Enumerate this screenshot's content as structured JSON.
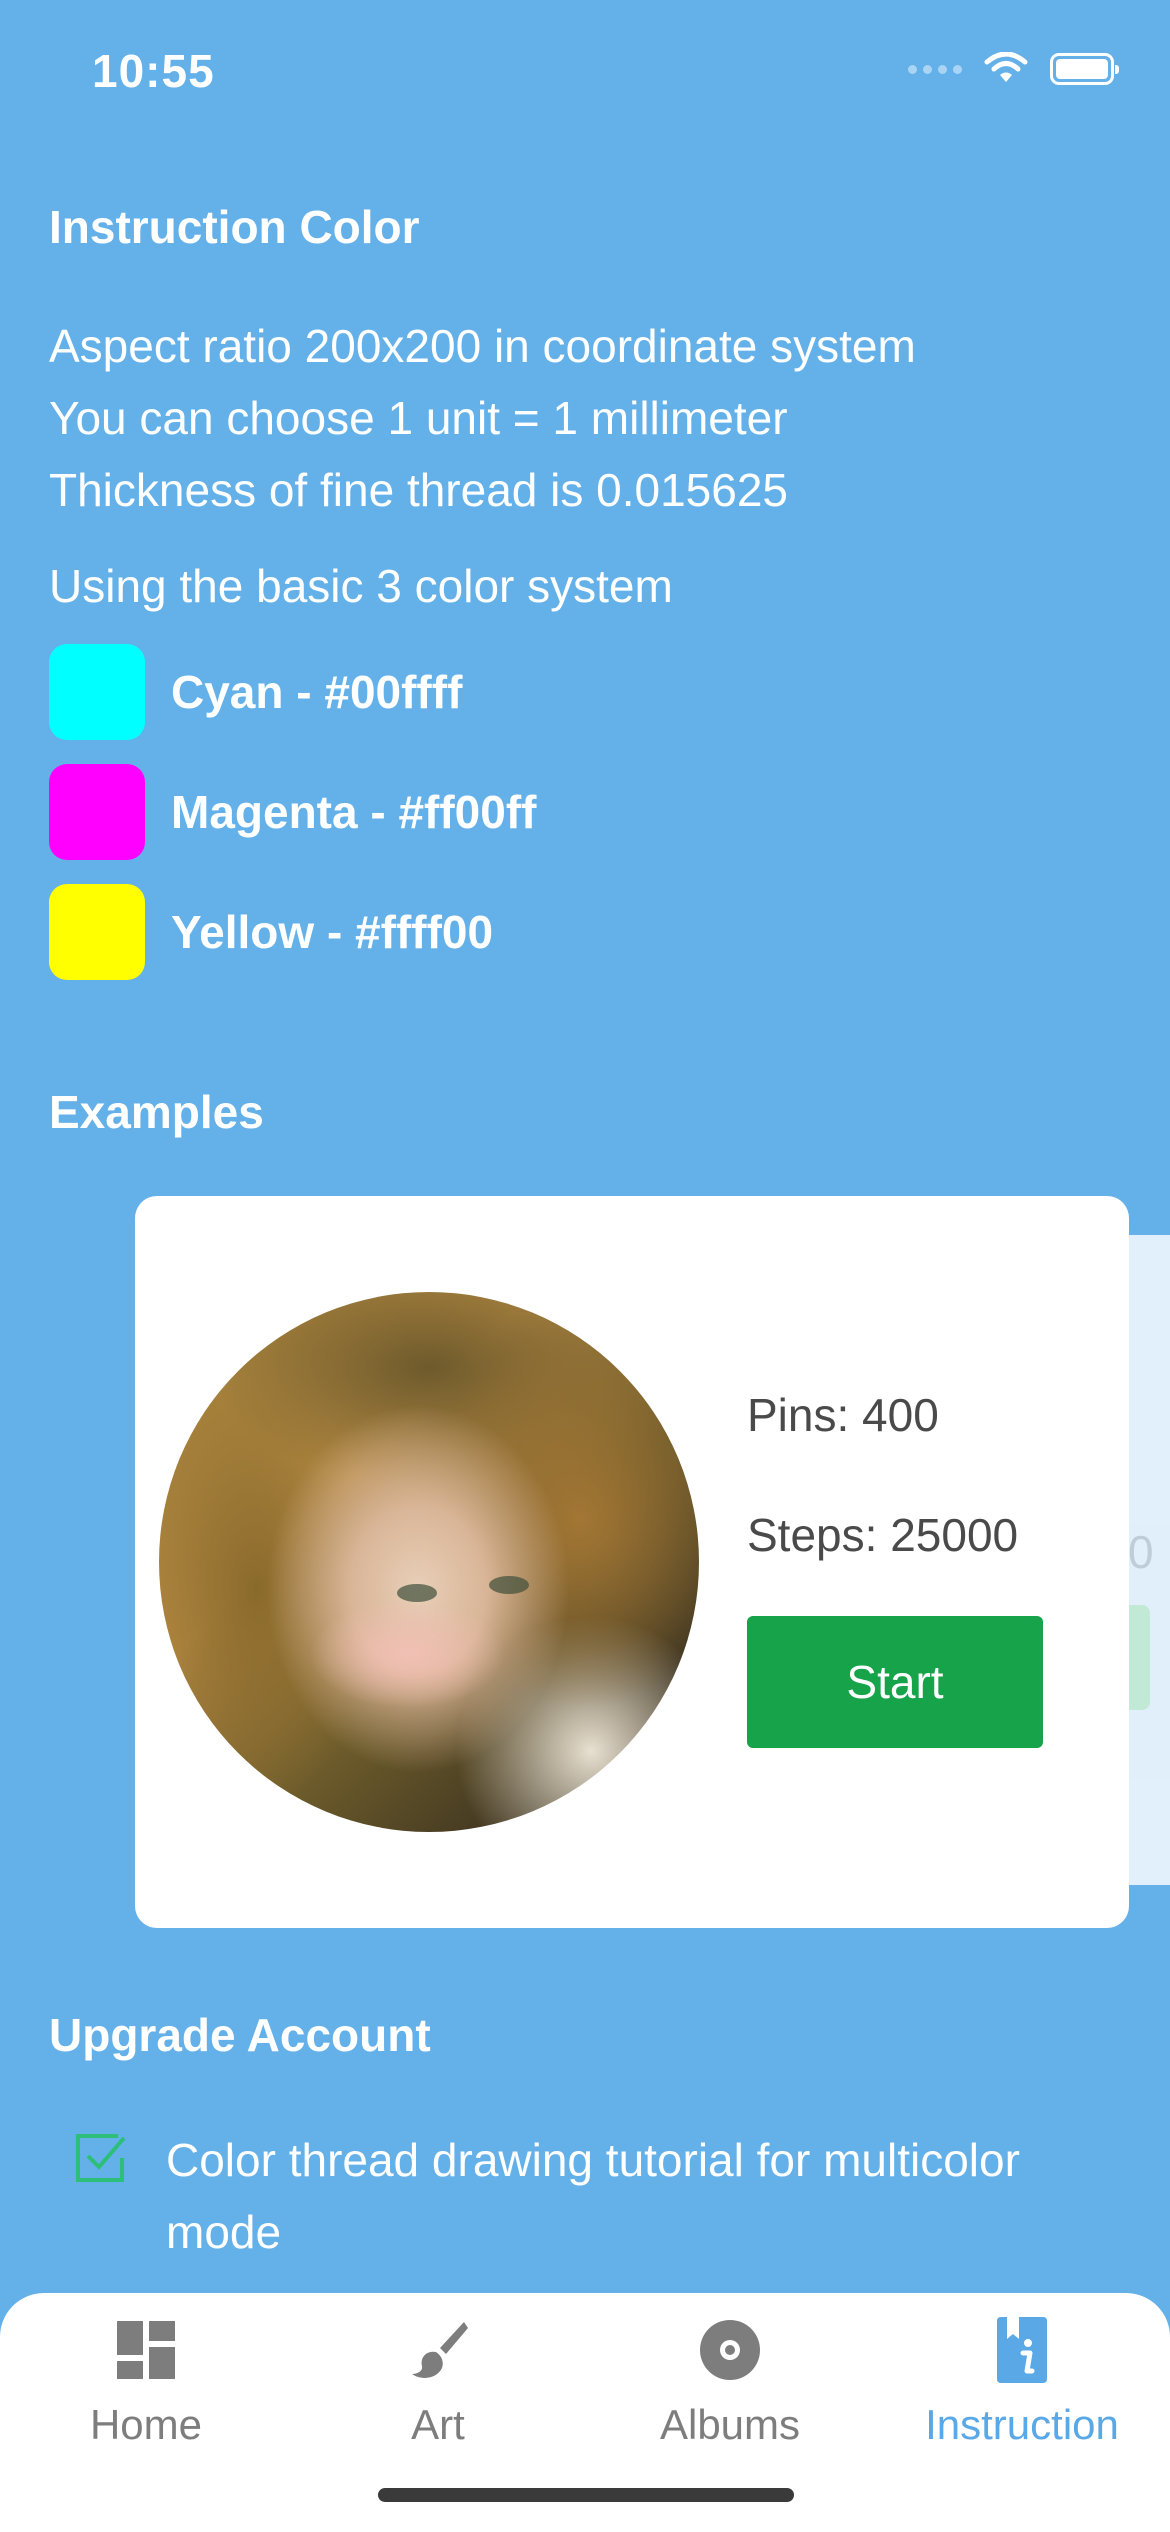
{
  "status_bar": {
    "time": "10:55"
  },
  "instruction": {
    "title": "Instruction Color",
    "lines": [
      "Aspect ratio 200x200 in coordinate system",
      "You can choose 1 unit = 1 millimeter",
      "Thickness of fine thread is 0.015625"
    ],
    "basic_line": "Using the basic 3 color system",
    "colors": [
      {
        "label": "Cyan - #00ffff",
        "hex": "#00ffff"
      },
      {
        "label": "Magenta - #ff00ff",
        "hex": "#ff00ff"
      },
      {
        "label": "Yellow - #ffff00",
        "hex": "#ffff00"
      }
    ]
  },
  "examples": {
    "title": "Examples",
    "card": {
      "pins": "Pins: 400",
      "steps": "Steps: 25000",
      "start_label": "Start"
    },
    "next_card_partial_text": "0"
  },
  "upgrade": {
    "title": "Upgrade Account",
    "items": [
      "Color thread drawing tutorial for multicolor mode"
    ]
  },
  "tabbar": {
    "tabs": [
      {
        "label": "Home",
        "icon": "dashboard-icon"
      },
      {
        "label": "Art",
        "icon": "brush-icon"
      },
      {
        "label": "Albums",
        "icon": "disc-icon"
      },
      {
        "label": "Instruction",
        "icon": "info-book-icon",
        "active": true
      }
    ],
    "active_color": "#5aa8e6",
    "inactive_color": "#7d7d7d"
  },
  "theme": {
    "background": "#64b1ea",
    "start_button": "#17a34a",
    "check_color": "#2dbf7a"
  }
}
